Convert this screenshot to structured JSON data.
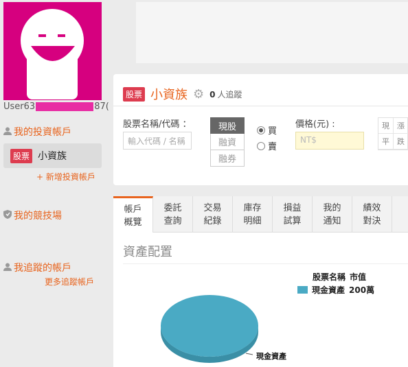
{
  "profile": {
    "username_prefix": "User63",
    "username_suffix": "87("
  },
  "sidebar": {
    "my_accounts_heading": "我的投資帳戶",
    "account": {
      "tag": "股票",
      "name": "小資族"
    },
    "add_account_link": "+ 新增投資帳戶",
    "arena_heading": "我的競技場",
    "followed_heading": "我追蹤的帳戶",
    "more_followed_link": "更多追蹤帳戶"
  },
  "trade": {
    "tag": "股票",
    "account_name": "小資族",
    "follower_count": "0",
    "follower_label": "人追蹤",
    "stock_label": "股票名稱/代碼 ：",
    "stock_placeholder": "輸入代碼 / 名稱",
    "order_types": [
      "現股",
      "融資",
      "融券"
    ],
    "active_order_type": "現股",
    "side_buy": "買",
    "side_sell": "賣",
    "selected_side": "買",
    "price_label": "價格(元) :",
    "price_placeholder": "NT$",
    "limit_cells": [
      "現",
      "漲",
      "平",
      "跌"
    ]
  },
  "tabs": [
    {
      "line1": "帳戶",
      "line2": "概覽"
    },
    {
      "line1": "委託",
      "line2": "查詢"
    },
    {
      "line1": "交易",
      "line2": "紀錄"
    },
    {
      "line1": "庫存",
      "line2": "明細"
    },
    {
      "line1": "損益",
      "line2": "試算"
    },
    {
      "line1": "我的",
      "line2": "通知"
    },
    {
      "line1": "績效",
      "line2": "對決"
    }
  ],
  "active_tab": 0,
  "asset": {
    "title": "資產配置",
    "legend_header_name": "股票名稱",
    "legend_header_value": "市值",
    "legend_items": [
      {
        "name": "現金資產",
        "value": "200萬",
        "color": "#4aaac4"
      }
    ],
    "slice_label": "現金資產"
  },
  "chart_data": {
    "type": "pie",
    "categories": [
      "現金資產"
    ],
    "values": [
      100
    ],
    "colors": [
      "#4aaac4"
    ]
  },
  "colors": {
    "accent": "#e8641e",
    "avatar_bg": "#d6007f",
    "stock_tag": "#dd3c4f"
  }
}
